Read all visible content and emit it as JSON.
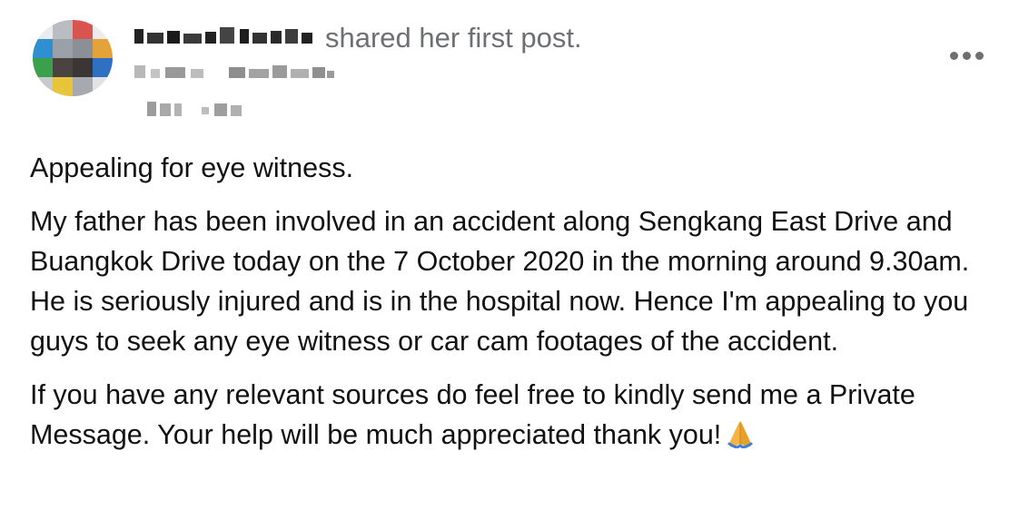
{
  "post": {
    "author_name_blurred": "",
    "action_text": "shared her first post.",
    "member_badge_blurred": "",
    "timestamp_blurred": "",
    "more_icon": "ellipsis-horizontal-icon",
    "paragraphs": [
      "Appealing for eye witness.",
      "My father has been involved in an accident along Sengkang East Drive and Buangkok Drive today on the 7 October 2020 in the morning around 9.30am. He is seriously injured and is in the hospital now. Hence I'm appealing to you guys to seek any eye witness or car cam footages of the accident.",
      "If you have any relevant sources do feel free to kindly send me a Private Message. Your help will be much appreciated thank you!"
    ],
    "trailing_emoji_icon": "folded-hands-icon"
  },
  "colors": {
    "text_primary": "#111111",
    "text_secondary": "#6d6f73",
    "emoji": "#f5b342"
  }
}
